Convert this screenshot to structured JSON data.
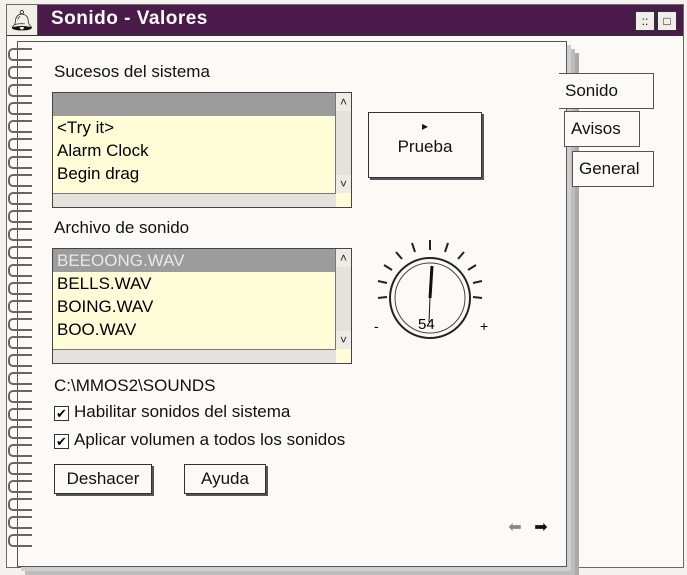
{
  "window": {
    "title": "Sonido - Valores",
    "restore_glyph": "::",
    "maximize_glyph": "□"
  },
  "tabs": [
    {
      "label": "Sonido"
    },
    {
      "label": "Avisos"
    },
    {
      "label": "General"
    }
  ],
  "events": {
    "label": "Sucesos del sistema",
    "items": [
      "",
      "<Try it>",
      "Alarm Clock",
      "Begin drag"
    ]
  },
  "test_button": {
    "arrow": "▸",
    "label": "Prueba"
  },
  "sound_file": {
    "label": "Archivo de sonido",
    "items": [
      "BEEOONG.WAV",
      "BELLS.WAV",
      "BOING.WAV",
      "BOO.WAV"
    ],
    "path": "C:\\MMOS2\\SOUNDS"
  },
  "volume": {
    "value": "54",
    "minus": "-",
    "plus": "+"
  },
  "options": [
    {
      "label": "Habilitar sonidos del sistema",
      "checked": true
    },
    {
      "label": "Aplicar volumen a todos los sonidos",
      "checked": true
    }
  ],
  "buttons": {
    "undo": "Deshacer",
    "help": "Ayuda"
  },
  "nav": {
    "back": "⬅",
    "forward": "➡"
  }
}
